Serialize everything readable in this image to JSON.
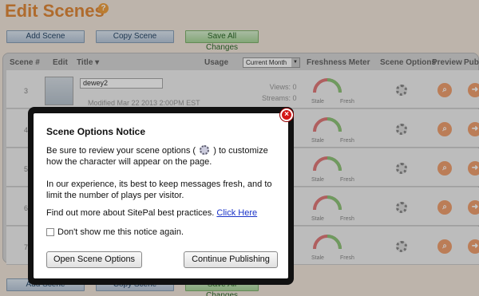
{
  "page": {
    "title": "Edit Scenes",
    "help_glyph": "?"
  },
  "toolbar": {
    "add_scene": "Add Scene",
    "copy_scene": "Copy Scene",
    "save_all": "Save All Changes"
  },
  "table": {
    "headers": {
      "scene_num": "Scene #",
      "edit": "Edit",
      "title": "Title ▾",
      "usage": "Usage",
      "freshness": "Freshness Meter",
      "scene_options": "Scene Options",
      "preview": "Preview",
      "publish": "Publi"
    },
    "usage_select": "Current Month",
    "rows": [
      {
        "num": "3",
        "name": "dewey2",
        "modified": "Modified Mar 22 2013 2:00PM EST",
        "views": "Views:",
        "views_val": "0",
        "streams": "Streams:",
        "streams_val": "0"
      },
      {
        "num": "4"
      },
      {
        "num": "5"
      },
      {
        "num": "6"
      },
      {
        "num": "7"
      }
    ],
    "gauge_labels": {
      "stale": "Stale",
      "fresh": "Fresh"
    }
  },
  "modal": {
    "close_glyph": "×",
    "title": "Scene Options Notice",
    "para1_before": "Be sure to review your scene options (",
    "para1_after": ") to customize how the character will appear on the page.",
    "para2": "In our experience, its best to keep messages fresh, and to limit the number of plays per visitor.",
    "para3": "Find out more about SitePal best practices.",
    "link": "Click Here",
    "checkbox_label": "Don't show me this notice again.",
    "open_button": "Open Scene Options",
    "continue_button": "Continue Publishing"
  }
}
